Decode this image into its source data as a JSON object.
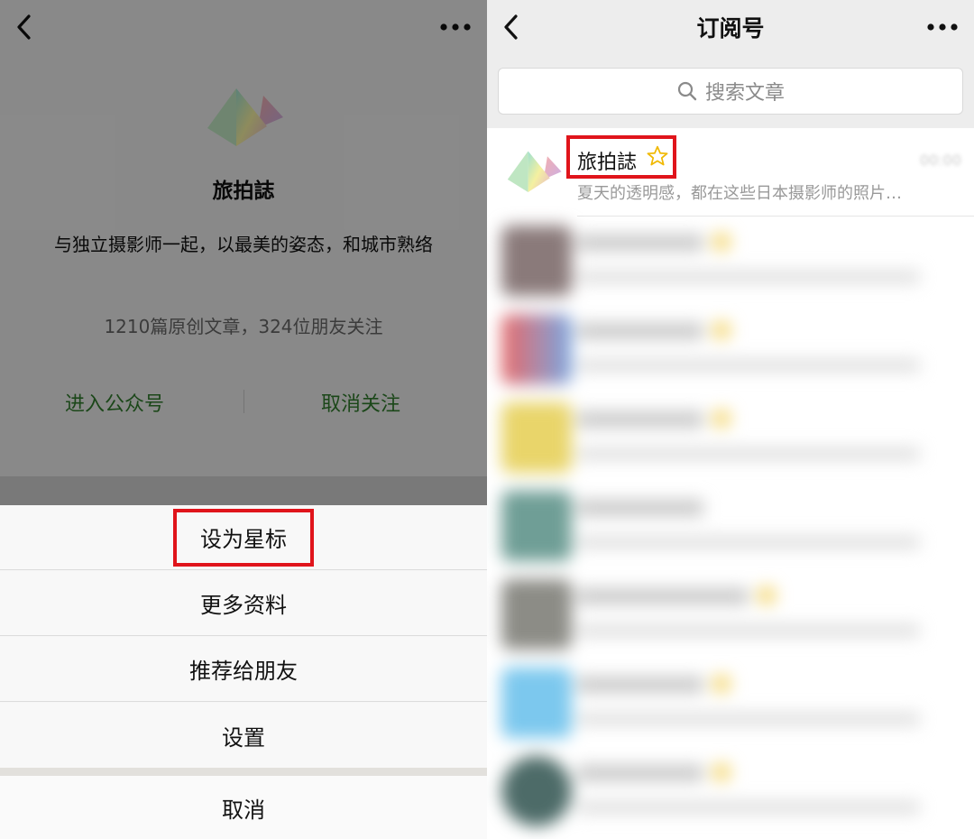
{
  "left": {
    "account": {
      "name": "旅拍誌",
      "description": "与独立摄影师一起，以最美的姿态，和城市熟络",
      "stats": "1210篇原创文章，324位朋友关注",
      "actions": {
        "enter": "进入公众号",
        "unfollow": "取消关注"
      }
    },
    "action_sheet": {
      "items": [
        {
          "label": "设为星标",
          "highlighted": true
        },
        {
          "label": "更多资料"
        },
        {
          "label": "推荐给朋友"
        },
        {
          "label": "设置"
        }
      ],
      "cancel": "取消"
    }
  },
  "right": {
    "title": "订阅号",
    "search": {
      "placeholder": "搜索文章"
    },
    "first_item": {
      "name": "旅拍誌",
      "preview": "夏天的透明感，都在这些日本摄影师的照片…",
      "starred": true
    }
  },
  "icons": [
    "back-arrow-icon",
    "more-dots-icon",
    "search-icon",
    "star-outline-icon",
    "pyramid-logo-icon"
  ],
  "colors": {
    "highlight": "#e0141b",
    "action_green": "#2f7a2b",
    "star": "#f0b800",
    "blur_avatars": [
      "#8a7a7a",
      "#e76a6a",
      "#e9d56a",
      "#6f9e96",
      "#8c8c86",
      "#7cc8ee",
      "#4d6b68"
    ]
  }
}
